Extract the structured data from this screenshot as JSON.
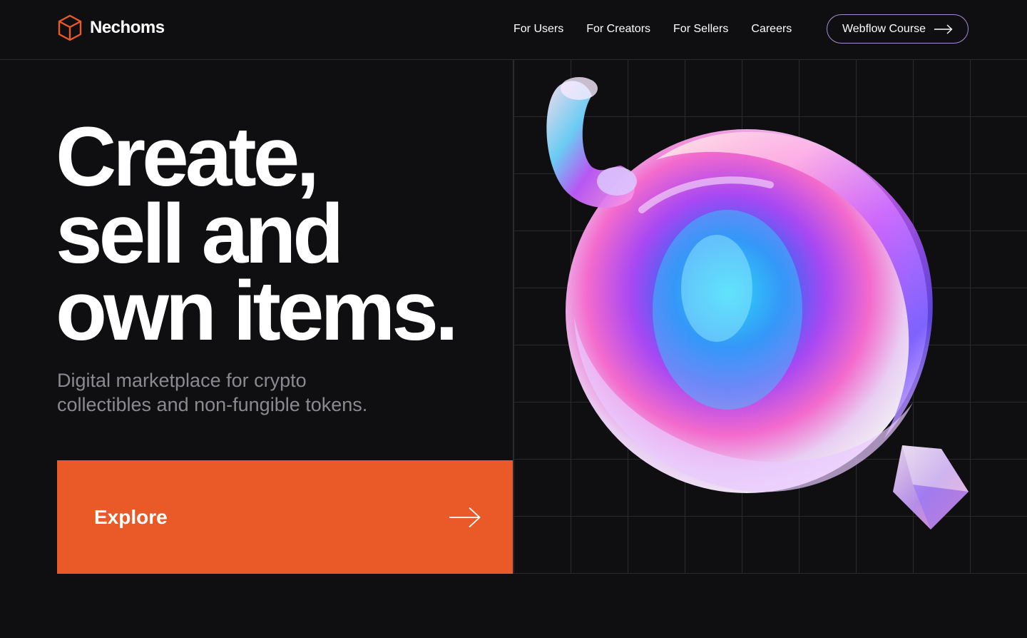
{
  "brand": {
    "name": "Nechoms",
    "icon": "cube-icon",
    "accent": "#ea5a29"
  },
  "nav": {
    "items": [
      {
        "label": "For Users"
      },
      {
        "label": "For Creators"
      },
      {
        "label": "For Sellers"
      },
      {
        "label": "Careers"
      }
    ],
    "cta_label": "Webflow Course",
    "cta_icon": "arrow-right-icon"
  },
  "hero": {
    "headline_lines": [
      "Create,",
      "sell and",
      "own items."
    ],
    "subtitle_line1": "Digital marketplace for crypto",
    "subtitle_line2": "collectibles and non-fungible tokens.",
    "explore_label": "Explore",
    "explore_icon": "arrow-right-icon",
    "explore_color": "#ea5a29"
  },
  "artwork": {
    "objects": [
      "iridescent-torus-shape",
      "iridescent-sphere-shape",
      "iridescent-cube-shape"
    ]
  }
}
